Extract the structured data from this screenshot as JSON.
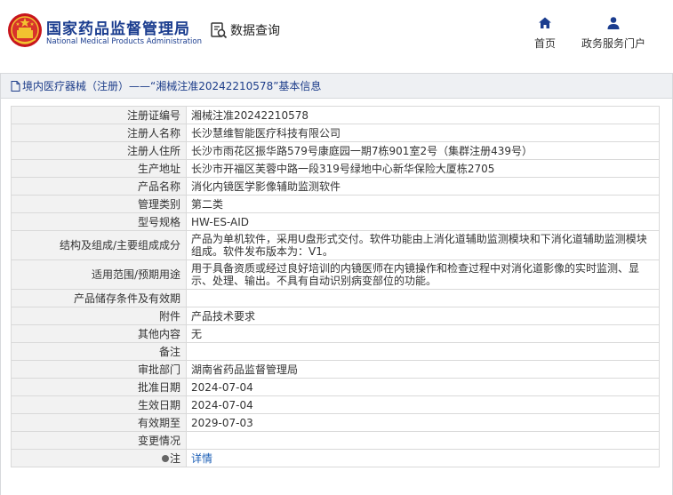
{
  "header": {
    "brand_cn": "国家药品监督管理局",
    "brand_en": "National Medical Products Administration",
    "query_label": "数据查询",
    "nav": [
      {
        "label": "首页",
        "icon": "home-icon"
      },
      {
        "label": "政务服务门户",
        "icon": "user-icon"
      }
    ]
  },
  "breadcrumb": {
    "text": "境内医疗器械（注册）——“湘械注准20242210578”基本信息"
  },
  "details": {
    "rows": [
      {
        "key": "注册证编号",
        "value": "湘械注准20242210578"
      },
      {
        "key": "注册人名称",
        "value": "长沙慧维智能医疗科技有限公司"
      },
      {
        "key": "注册人住所",
        "value": "长沙市雨花区振华路579号康庭园一期7栋901室2号（集群注册439号）"
      },
      {
        "key": "生产地址",
        "value": "长沙市开福区芙蓉中路一段319号绿地中心新华保险大厦栋2705"
      },
      {
        "key": "产品名称",
        "value": "消化内镜医学影像辅助监测软件"
      },
      {
        "key": "管理类别",
        "value": "第二类"
      },
      {
        "key": "型号规格",
        "value": "HW-ES-AID"
      },
      {
        "key": "结构及组成/主要组成成分",
        "value": "产品为单机软件，采用U盘形式交付。软件功能由上消化道辅助监测模块和下消化道辅助监测模块组成。软件发布版本为：V1。"
      },
      {
        "key": "适用范围/预期用途",
        "value": "用于具备资质或经过良好培训的内镜医师在内镜操作和检查过程中对消化道影像的实时监测、显示、处理、输出。不具有自动识别病变部位的功能。"
      },
      {
        "key": "产品储存条件及有效期",
        "value": ""
      },
      {
        "key": "附件",
        "value": "产品技术要求"
      },
      {
        "key": "其他内容",
        "value": "无"
      },
      {
        "key": "备注",
        "value": ""
      },
      {
        "key": "审批部门",
        "value": "湖南省药品监督管理局"
      },
      {
        "key": "批准日期",
        "value": "2024-07-04"
      },
      {
        "key": "生效日期",
        "value": "2024-07-04"
      },
      {
        "key": "有效期至",
        "value": "2029-07-03"
      },
      {
        "key": "变更情况",
        "value": ""
      }
    ],
    "note_key": "注",
    "note_link": "详情"
  },
  "colors": {
    "brand": "#1b3d8f",
    "link": "#1d5fb6",
    "key_bg": "#f2f2f2",
    "crumb_bg": "#eef0f3"
  }
}
